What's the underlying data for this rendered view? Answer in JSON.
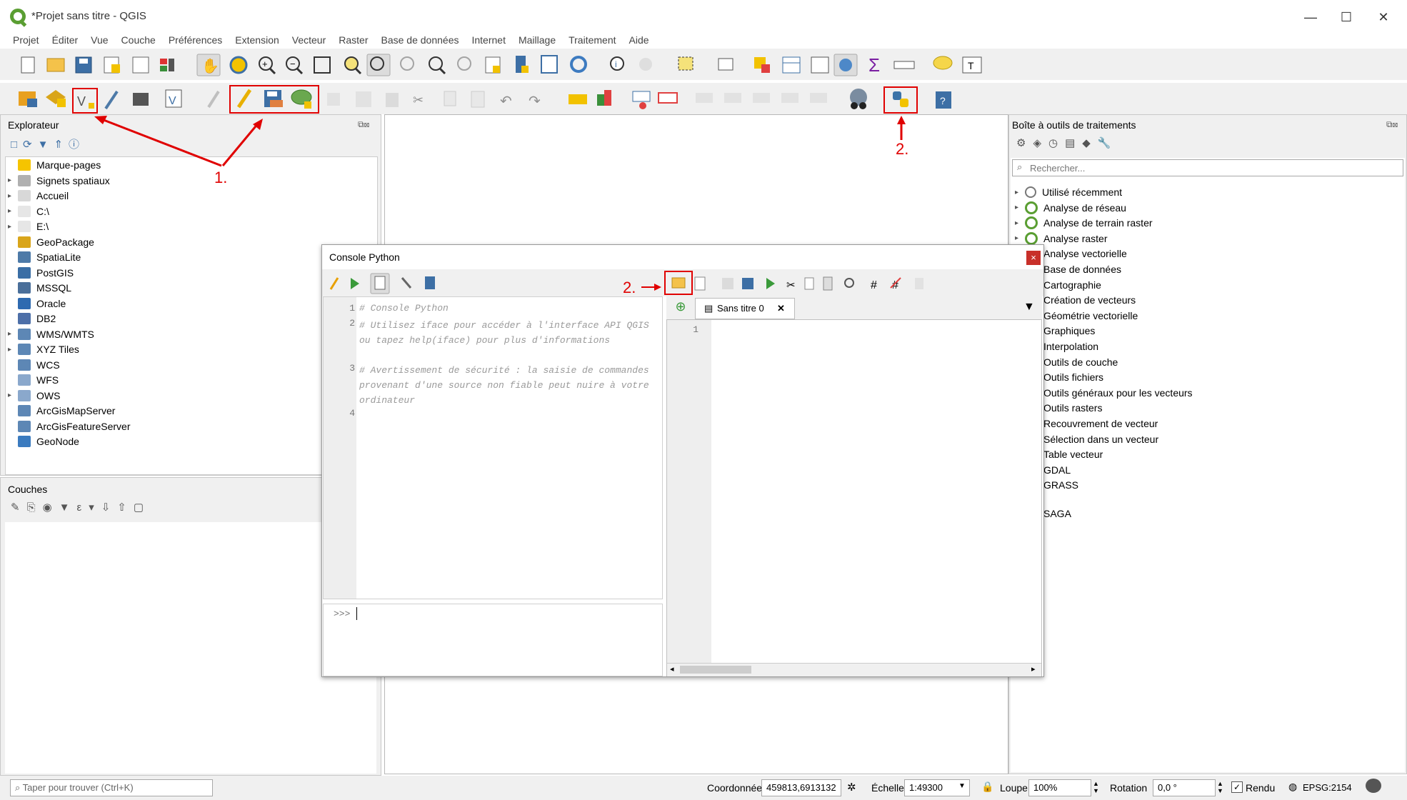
{
  "window": {
    "title": "*Projet sans titre - QGIS",
    "minimize": "—",
    "maximize": "☐",
    "close": "✕"
  },
  "menu": [
    "Projet",
    "Éditer",
    "Vue",
    "Couche",
    "Préférences",
    "Extension",
    "Vecteur",
    "Raster",
    "Base de données",
    "Internet",
    "Maillage",
    "Traitement",
    "Aide"
  ],
  "explorer": {
    "title": "Explorateur",
    "items": [
      {
        "label": "Marque-pages",
        "icon": "star-icon",
        "color": "#f5c400",
        "arrow": false
      },
      {
        "label": "Signets spatiaux",
        "icon": "bookmark-icon",
        "color": "#b0b0b0",
        "arrow": true
      },
      {
        "label": "Accueil",
        "icon": "home-folder-icon",
        "color": "#d8d8d8",
        "arrow": true
      },
      {
        "label": "C:\\",
        "icon": "folder-icon",
        "color": "#e6e6e6",
        "arrow": true
      },
      {
        "label": "E:\\",
        "icon": "folder-icon",
        "color": "#e6e6e6",
        "arrow": true
      },
      {
        "label": "GeoPackage",
        "icon": "geopackage-icon",
        "color": "#d9a51a",
        "arrow": false
      },
      {
        "label": "SpatiaLite",
        "icon": "spatialite-icon",
        "color": "#4d7aa8",
        "arrow": false
      },
      {
        "label": "PostGIS",
        "icon": "postgis-icon",
        "color": "#3a6ea5",
        "arrow": false
      },
      {
        "label": "MSSQL",
        "icon": "mssql-icon",
        "color": "#4a6f9a",
        "arrow": false
      },
      {
        "label": "Oracle",
        "icon": "oracle-icon",
        "color": "#2e6ab0",
        "arrow": false
      },
      {
        "label": "DB2",
        "icon": "db2-icon",
        "color": "#4d6fa8",
        "arrow": false
      },
      {
        "label": "WMS/WMTS",
        "icon": "globe-icon",
        "color": "#5d87b5",
        "arrow": true
      },
      {
        "label": "XYZ Tiles",
        "icon": "globe-icon",
        "color": "#5d87b5",
        "arrow": true
      },
      {
        "label": "WCS",
        "icon": "globe-icon",
        "color": "#5d87b5",
        "arrow": false
      },
      {
        "label": "WFS",
        "icon": "globe-icon",
        "color": "#8aa8cc",
        "arrow": false
      },
      {
        "label": "OWS",
        "icon": "globe-icon",
        "color": "#8aa8cc",
        "arrow": true
      },
      {
        "label": "ArcGisMapServer",
        "icon": "globe-icon",
        "color": "#5d87b5",
        "arrow": false
      },
      {
        "label": "ArcGisFeatureServer",
        "icon": "globe-icon",
        "color": "#5d87b5",
        "arrow": false
      },
      {
        "label": "GeoNode",
        "icon": "geonode-icon",
        "color": "#3b7bbf",
        "arrow": false
      }
    ]
  },
  "layers": {
    "title": "Couches"
  },
  "console": {
    "title": "Console Python",
    "close": "×",
    "lines": [
      {
        "num": "1",
        "text": "# Console Python"
      },
      {
        "num": "2",
        "text": "# Utilisez iface pour accéder à l'interface API QGIS ou tapez help(iface) pour plus d'informations"
      },
      {
        "num": "3",
        "text": "# Avertissement de sécurité : la saisie de commandes provenant d'une source non fiable peut nuire à votre ordinateur"
      },
      {
        "num": "4",
        "text": ""
      }
    ],
    "prompt": ">>>",
    "editor_tab": "Sans titre 0",
    "editor_tab_close": "✕",
    "editor_line": "1"
  },
  "processing": {
    "title": "Boîte à outils de traitements",
    "search_placeholder": "Rechercher...",
    "items": [
      {
        "label": "Utilisé récemment",
        "arrow": true,
        "icon": "clock-icon"
      },
      {
        "label": "Analyse de réseau",
        "arrow": true,
        "icon": "qgis-icon"
      },
      {
        "label": "Analyse de terrain raster",
        "arrow": true,
        "icon": "qgis-icon"
      },
      {
        "label": "Analyse raster",
        "arrow": true,
        "icon": "qgis-icon"
      },
      {
        "label": "Analyse vectorielle",
        "arrow": false,
        "icon": ""
      },
      {
        "label": "Base de données",
        "arrow": false,
        "icon": ""
      },
      {
        "label": "Cartographie",
        "arrow": false,
        "icon": ""
      },
      {
        "label": "Création de vecteurs",
        "arrow": false,
        "icon": ""
      },
      {
        "label": "Géométrie vectorielle",
        "arrow": false,
        "icon": ""
      },
      {
        "label": "Graphiques",
        "arrow": false,
        "icon": ""
      },
      {
        "label": "Interpolation",
        "arrow": false,
        "icon": ""
      },
      {
        "label": "Outils de couche",
        "arrow": false,
        "icon": ""
      },
      {
        "label": "Outils fichiers",
        "arrow": false,
        "icon": ""
      },
      {
        "label": "Outils généraux pour les vecteurs",
        "arrow": false,
        "icon": ""
      },
      {
        "label": "Outils rasters",
        "arrow": false,
        "icon": ""
      },
      {
        "label": "Recouvrement de vecteur",
        "arrow": false,
        "icon": ""
      },
      {
        "label": "Sélection dans un vecteur",
        "arrow": false,
        "icon": ""
      },
      {
        "label": "Table vecteur",
        "arrow": false,
        "icon": ""
      },
      {
        "label": "GDAL",
        "arrow": false,
        "icon": ""
      },
      {
        "label": "GRASS",
        "arrow": false,
        "icon": ""
      },
      {
        "label": "SAGA",
        "arrow": false,
        "icon": ""
      }
    ]
  },
  "status": {
    "locator_placeholder": "Taper pour trouver (Ctrl+K)",
    "coord_label": "Coordonnée",
    "coord_value": "459813,6913132",
    "scale_label": "Échelle",
    "scale_value": "1:49300",
    "magnifier_label": "Loupe",
    "magnifier_value": "100%",
    "rotation_label": "Rotation",
    "rotation_value": "0,0 °",
    "render_label": "Rendu",
    "crs": "EPSG:2154"
  },
  "annotations": {
    "one": "1.",
    "two_top": "2.",
    "two_console": "2."
  },
  "colors": {
    "accent_red": "#e00000",
    "qgis_green": "#5a9e32"
  }
}
